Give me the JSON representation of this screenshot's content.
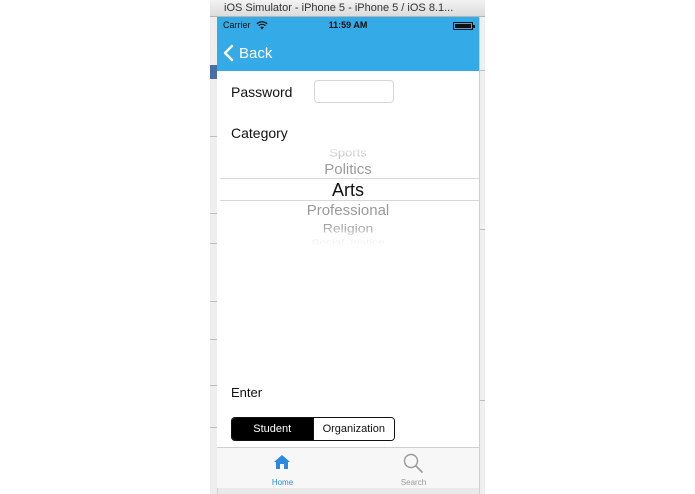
{
  "window": {
    "title": "iOS Simulator - iPhone 5 - iPhone 5 / iOS 8.1..."
  },
  "status_bar": {
    "carrier": "Carrier",
    "time": "11:59 AM"
  },
  "nav": {
    "back_label": "Back"
  },
  "form": {
    "password_label": "Password",
    "password_value": "",
    "category_label": "Category",
    "enter_label": "Enter"
  },
  "picker": {
    "options": [
      "Sports",
      "Politics",
      "Arts",
      "Professional",
      "Religion",
      "Social Justice"
    ],
    "selected": "Arts"
  },
  "segmented": {
    "options": [
      "Student",
      "Organization"
    ],
    "selected": "Student"
  },
  "tabbar": {
    "items": [
      {
        "label": "Home"
      },
      {
        "label": "Search"
      }
    ],
    "active": "Home"
  },
  "colors": {
    "accent": "#34aae6",
    "tab_active": "#2a8ae0",
    "tab_inactive": "#9a9a9a"
  }
}
